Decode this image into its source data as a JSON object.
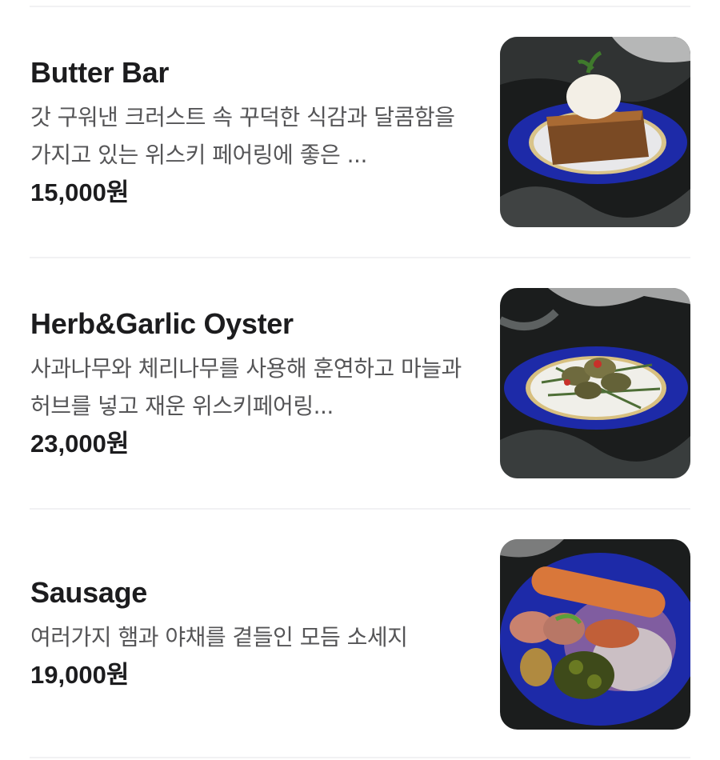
{
  "menu": {
    "items": [
      {
        "name": "Butter Bar",
        "description": "갓 구워낸 크러스트 속 꾸덕한 식감과 달콤함을 가지고 있는 위스키 페어링에 좋은 ...",
        "price": "15,000원",
        "photo_icon": "butter-bar-dessert-photo"
      },
      {
        "name": "Herb&Garlic Oyster",
        "description": "사과나무와 체리나무를 사용해 훈연하고 마늘과 허브를 넣고 재운 위스키페어링...",
        "price": "23,000원",
        "photo_icon": "smoked-oyster-photo"
      },
      {
        "name": "Sausage",
        "description": "여러가지 햄과 야채를 곁들인 모듬 소세지",
        "price": "19,000원",
        "photo_icon": "sausage-platter-photo"
      }
    ]
  },
  "colors": {
    "title": "#1c1c1e",
    "description": "#555557",
    "divider": "#f1f1f3",
    "plate_blue": "#1e2aa0"
  }
}
